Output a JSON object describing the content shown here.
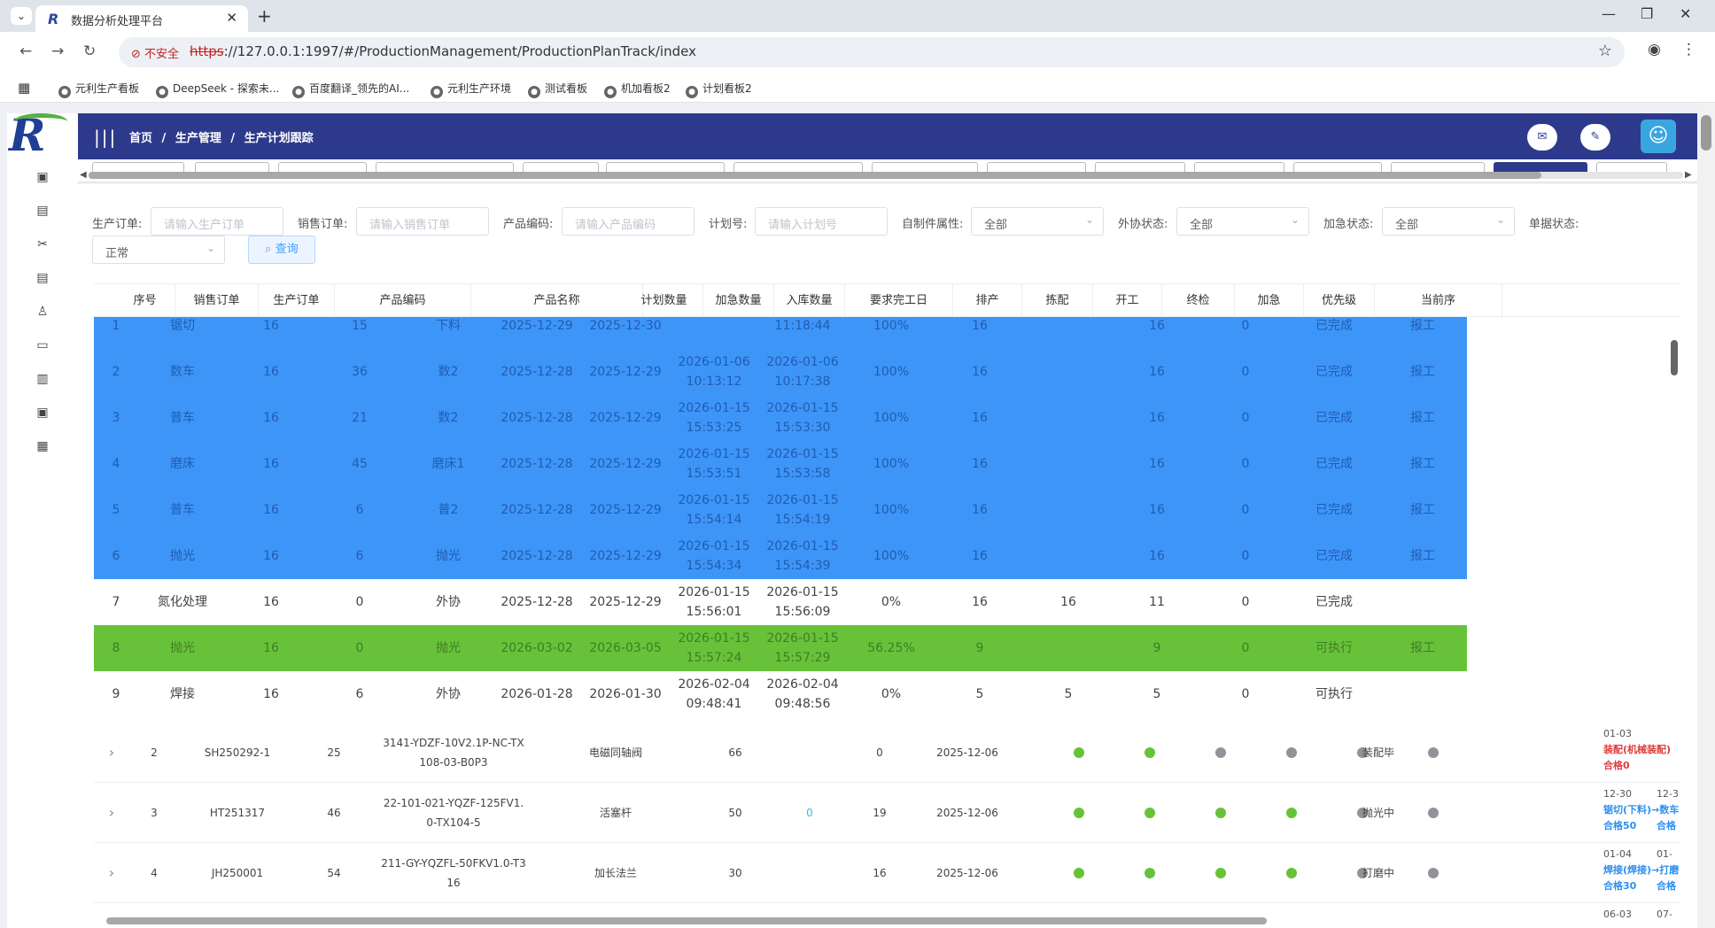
{
  "browser": {
    "tab_title": "数据分析处理平台",
    "insecure_label": "不安全",
    "url_scheme": "https",
    "url_rest": "://127.0.0.1:1997/#/ProductionManagement/ProductionPlanTrack/index",
    "bookmarks": [
      "元利生产看板",
      "DeepSeek - 探索未...",
      "百度翻译_领先的AI...",
      "元利生产环境",
      "测试看板",
      "机加看板2",
      "计划看板2"
    ]
  },
  "header": {
    "breadcrumb": [
      "首页",
      "生产管理",
      "生产计划跟踪"
    ]
  },
  "filters": {
    "prod_order_label": "生产订单:",
    "prod_order_ph": "请输入生产订单",
    "sales_order_label": "销售订单:",
    "sales_order_ph": "请输入销售订单",
    "product_code_label": "产品编码:",
    "product_code_ph": "请输入产品编码",
    "plan_no_label": "计划号:",
    "plan_no_ph": "请输入计划号",
    "self_made_label": "自制件属性:",
    "self_made_value": "全部",
    "outsource_label": "外协状态:",
    "outsource_value": "全部",
    "urgent_label": "加急状态:",
    "urgent_value": "全部",
    "doc_status_label": "单据状态:",
    "doc_status_value": "正常",
    "query_button": "查询"
  },
  "table_headers": [
    "序号",
    "销售订单",
    "生产订单",
    "产品编码",
    "产品名称",
    "计划数量",
    "加急数量",
    "入库数量",
    "要求完工日",
    "排产",
    "拣配",
    "开工",
    "终检",
    "加急",
    "优先级",
    "当前序"
  ],
  "process_rows": [
    {
      "seq": "1",
      "name": "锯切",
      "a": "16",
      "b": "15",
      "code": "下料",
      "d1": "2025-12-29",
      "d2": "2025-12-30",
      "t1": "",
      "t2": "11:18:44",
      "pct": "100%",
      "n1": "16",
      "n2": "",
      "n3": "16",
      "n4": "0",
      "status": "已完成",
      "action": "报工",
      "color": "blue"
    },
    {
      "seq": "2",
      "name": "数车",
      "a": "16",
      "b": "36",
      "code": "数2",
      "d1": "2025-12-28",
      "d2": "2025-12-29",
      "t1": "2026-01-06 10:13:12",
      "t2": "2026-01-06 10:17:38",
      "pct": "100%",
      "n1": "16",
      "n2": "",
      "n3": "16",
      "n4": "0",
      "status": "已完成",
      "action": "报工",
      "color": "blue"
    },
    {
      "seq": "3",
      "name": "普车",
      "a": "16",
      "b": "21",
      "code": "数2",
      "d1": "2025-12-28",
      "d2": "2025-12-29",
      "t1": "2026-01-15 15:53:25",
      "t2": "2026-01-15 15:53:30",
      "pct": "100%",
      "n1": "16",
      "n2": "",
      "n3": "16",
      "n4": "0",
      "status": "已完成",
      "action": "报工",
      "color": "blue"
    },
    {
      "seq": "4",
      "name": "磨床",
      "a": "16",
      "b": "45",
      "code": "磨床1",
      "d1": "2025-12-28",
      "d2": "2025-12-29",
      "t1": "2026-01-15 15:53:51",
      "t2": "2026-01-15 15:53:58",
      "pct": "100%",
      "n1": "16",
      "n2": "",
      "n3": "16",
      "n4": "0",
      "status": "已完成",
      "action": "报工",
      "color": "blue"
    },
    {
      "seq": "5",
      "name": "普车",
      "a": "16",
      "b": "6",
      "code": "普2",
      "d1": "2025-12-28",
      "d2": "2025-12-29",
      "t1": "2026-01-15 15:54:14",
      "t2": "2026-01-15 15:54:19",
      "pct": "100%",
      "n1": "16",
      "n2": "",
      "n3": "16",
      "n4": "0",
      "status": "已完成",
      "action": "报工",
      "color": "blue"
    },
    {
      "seq": "6",
      "name": "抛光",
      "a": "16",
      "b": "6",
      "code": "抛光",
      "d1": "2025-12-28",
      "d2": "2025-12-29",
      "t1": "2026-01-15 15:54:34",
      "t2": "2026-01-15 15:54:39",
      "pct": "100%",
      "n1": "16",
      "n2": "",
      "n3": "16",
      "n4": "0",
      "status": "已完成",
      "action": "报工",
      "color": "blue"
    },
    {
      "seq": "7",
      "name": "氮化处理",
      "a": "16",
      "b": "0",
      "code": "外协",
      "d1": "2025-12-28",
      "d2": "2025-12-29",
      "t1": "2026-01-15 15:56:01",
      "t2": "2026-01-15 15:56:09",
      "pct": "0%",
      "n1": "16",
      "n2": "16",
      "n3": "11",
      "n4": "0",
      "status": "已完成",
      "action": "",
      "color": "white"
    },
    {
      "seq": "8",
      "name": "抛光",
      "a": "16",
      "b": "0",
      "code": "抛光",
      "d1": "2026-03-02",
      "d2": "2026-03-05",
      "t1": "2026-01-15 15:57:24",
      "t2": "2026-01-15 15:57:29",
      "pct": "56.25%",
      "n1": "9",
      "n2": "",
      "n3": "9",
      "n4": "0",
      "status": "可执行",
      "action": "报工",
      "color": "green"
    },
    {
      "seq": "9",
      "name": "焊接",
      "a": "16",
      "b": "6",
      "code": "外协",
      "d1": "2026-01-28",
      "d2": "2026-01-30",
      "t1": "2026-02-04 09:48:41",
      "t2": "2026-02-04 09:48:56",
      "pct": "0%",
      "n1": "5",
      "n2": "5",
      "n3": "5",
      "n4": "0",
      "status": "可执行",
      "action": "",
      "color": "white"
    }
  ],
  "main_rows": [
    {
      "seq": "2",
      "sales": "SH250292-1",
      "prod": "25",
      "code": "3141-YDZF-10V2.1P-NC-TX108-03-B0P3",
      "name": "电磁同轴阀",
      "plan": "66",
      "urgent": "",
      "stored": "0",
      "due": "2025-12-06",
      "dots": [
        "g",
        "g",
        "x",
        "x",
        "x",
        "x"
      ],
      "current": "装配毕",
      "s1": "01-03",
      "s2": "装配(机械装配)",
      "s3": "合格0",
      "s1b": "",
      "s3b": "",
      "tone": "red"
    },
    {
      "seq": "3",
      "sales": "HT251317",
      "prod": "46",
      "code": "22-101-021-YQZF-125FV1.0-TX104-5",
      "name": "活塞杆",
      "plan": "50",
      "urgent": "0",
      "stored": "19",
      "due": "2025-12-06",
      "dots": [
        "g",
        "g",
        "g",
        "g",
        "x",
        "x"
      ],
      "current": "抛光中",
      "s1": "12-30",
      "s2": "锯切(下料)→数车",
      "s3": "合格50",
      "s1b": "12-3",
      "s3b": "合格",
      "tone": "blue"
    },
    {
      "seq": "4",
      "sales": "JH250001",
      "prod": "54",
      "code": "211-GY-YQZFL-50FKV1.0-T316",
      "name": "加长法兰",
      "plan": "30",
      "urgent": "",
      "stored": "16",
      "due": "2025-12-06",
      "dots": [
        "g",
        "g",
        "g",
        "g",
        "x",
        "x"
      ],
      "current": "打磨中",
      "s1": "01-04",
      "s2": "焊接(焊接)→打磨",
      "s3": "合格30",
      "s1b": "01-",
      "s3b": "合格",
      "tone": "blue"
    }
  ],
  "tail_stage": {
    "s1": "06-03",
    "s1b": "07-"
  },
  "colors": {
    "header": "#2d3a8c",
    "row_blue": "#3e95f8",
    "row_green": "#67c23a",
    "dot_green": "#67c23a",
    "dot_gray": "#909399"
  }
}
